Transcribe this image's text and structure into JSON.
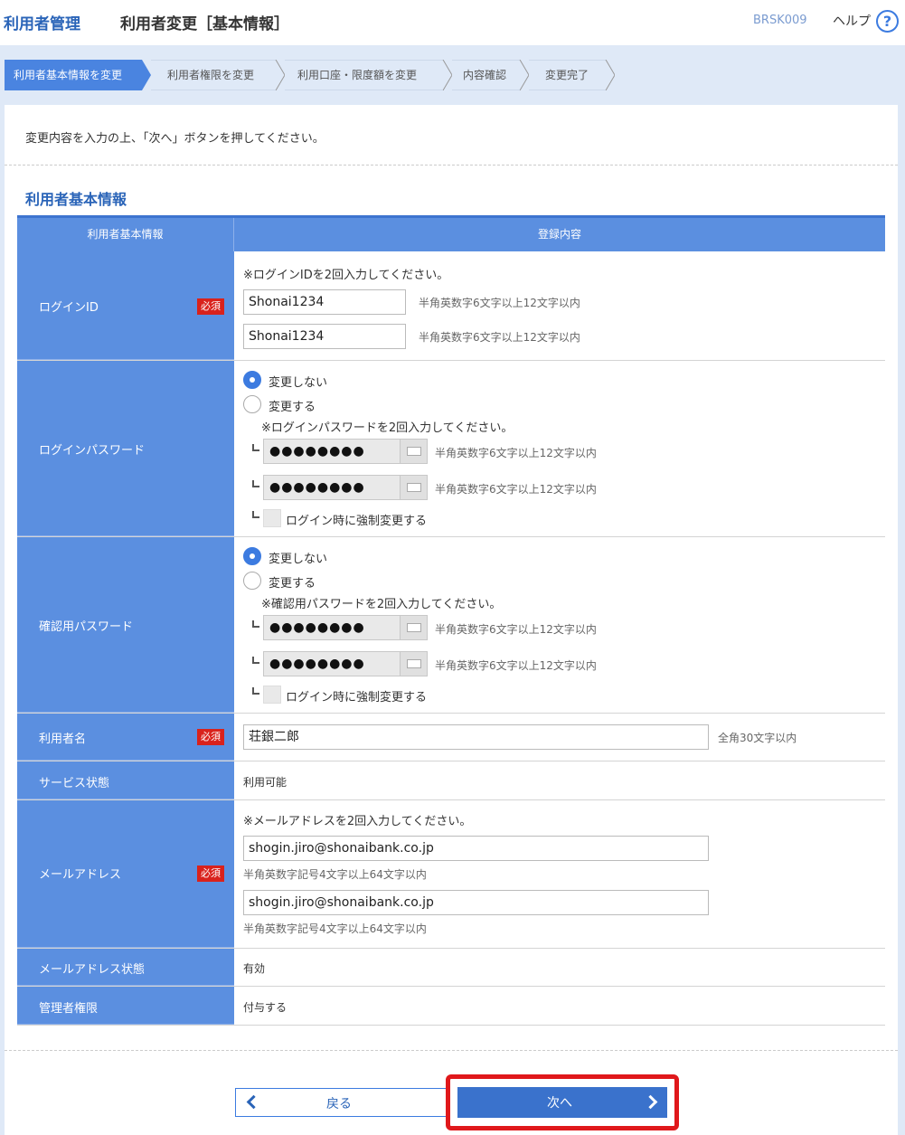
{
  "header": {
    "app_title": "利用者管理",
    "page_title": "利用者変更［基本情報］",
    "screen_code": "BRSK009",
    "help_label": "ヘルプ",
    "help_icon": "?"
  },
  "steps": [
    {
      "label": "利用者基本情報を変更",
      "active": true
    },
    {
      "label": "利用者権限を変更",
      "active": false
    },
    {
      "label": "利用口座・限度額を変更",
      "active": false
    },
    {
      "label": "内容確認",
      "active": false
    },
    {
      "label": "変更完了",
      "active": false
    }
  ],
  "intro": "変更内容を入力の上、「次へ」ボタンを押してください。",
  "section_title": "利用者基本情報",
  "table": {
    "col1_header": "利用者基本情報",
    "col2_header": "登録内容",
    "required_badge": "必須",
    "login_id": {
      "label": "ログインID",
      "note": "※ログインIDを2回入力してください。",
      "value1": "Shonai1234",
      "value2": "Shonai1234",
      "hint": "半角英数字6文字以上12文字以内"
    },
    "login_password": {
      "label": "ログインパスワード",
      "option_no_change": "変更しない",
      "option_change": "変更する",
      "selected": "変更しない",
      "note": "※ログインパスワードを2回入力してください。",
      "masked1": "●●●●●●●●",
      "masked2": "●●●●●●●●",
      "hint": "半角英数字6文字以上12文字以内",
      "force_change_label": "ログイン時に強制変更する"
    },
    "confirm_password": {
      "label": "確認用パスワード",
      "option_no_change": "変更しない",
      "option_change": "変更する",
      "selected": "変更しない",
      "note": "※確認用パスワードを2回入力してください。",
      "masked1": "●●●●●●●●",
      "masked2": "●●●●●●●●",
      "hint": "半角英数字6文字以上12文字以内",
      "force_change_label": "ログイン時に強制変更する"
    },
    "user_name": {
      "label": "利用者名",
      "value": "荘銀二郎",
      "hint": "全角30文字以内"
    },
    "service_status": {
      "label": "サービス状態",
      "value": "利用可能"
    },
    "email": {
      "label": "メールアドレス",
      "note": "※メールアドレスを2回入力してください。",
      "value1": "shogin.jiro@shonaibank.co.jp",
      "value2": "shogin.jiro@shonaibank.co.jp",
      "hint": "半角英数字記号4文字以上64文字以内"
    },
    "email_status": {
      "label": "メールアドレス状態",
      "value": "有効"
    },
    "admin_rights": {
      "label": "管理者権限",
      "value": "付与する"
    }
  },
  "buttons": {
    "back_label": "戻る",
    "next_label": "次へ"
  },
  "colors": {
    "accent": "#2a64b8",
    "table_header": "#5b8fe0",
    "active_step": "#4a84e0",
    "required": "#d9221c",
    "highlight": "#e0181b"
  }
}
